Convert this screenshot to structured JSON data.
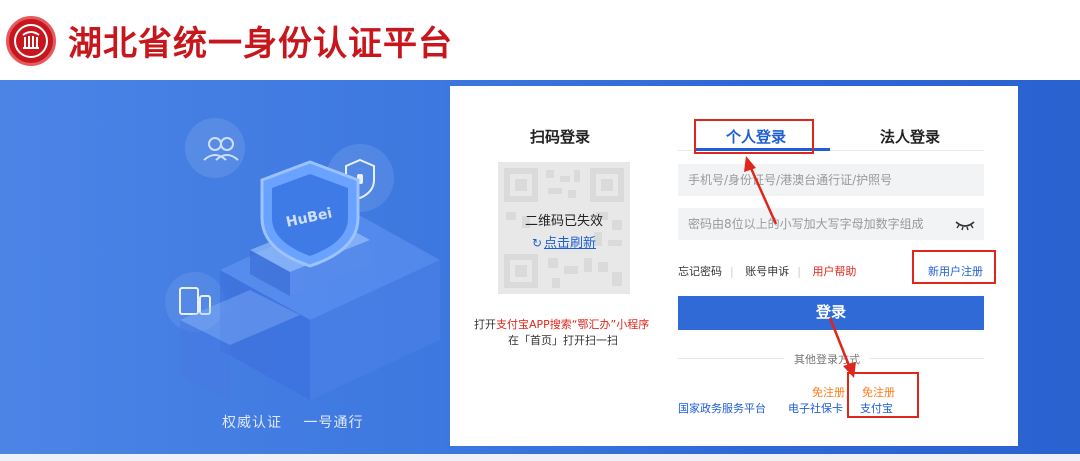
{
  "header": {
    "title": "湖北省统一身份认证平台"
  },
  "banner": {
    "slogan": [
      "权威认证",
      "一号通行"
    ],
    "shield_text": "HuBei"
  },
  "qr_login": {
    "title": "扫码登录",
    "expired_text": "二维码已失效",
    "refresh_label": "点击刷新",
    "hint_prefix": "打开",
    "hint_highlight": "支付宝APP搜索“鄂汇办”小程序",
    "hint_line2": "在「首页」打开扫一扫"
  },
  "tabs": {
    "personal": "个人登录",
    "legal": "法人登录"
  },
  "form": {
    "phone_placeholder": "手机号/身份证号/港澳台通行证/护照号",
    "password_placeholder": "密码由8位以上的小写加大写字母加数字组成",
    "forgot_password": "忘记密码",
    "account_appeal": "账号申诉",
    "user_help": "用户帮助",
    "register": "新用户注册",
    "login_button": "登录"
  },
  "other_login": {
    "label": "其他登录方式",
    "options": [
      {
        "label": "国家政务服务平台"
      },
      {
        "label": "电子社保卡",
        "tag": "免注册"
      },
      {
        "label": "支付宝",
        "tag": "免注册"
      }
    ]
  },
  "colors": {
    "brand_red": "#c8161d",
    "accent_blue": "#1f5fd6",
    "banner_blue": "#3d78e0",
    "tag_orange": "#ff7a1a"
  }
}
